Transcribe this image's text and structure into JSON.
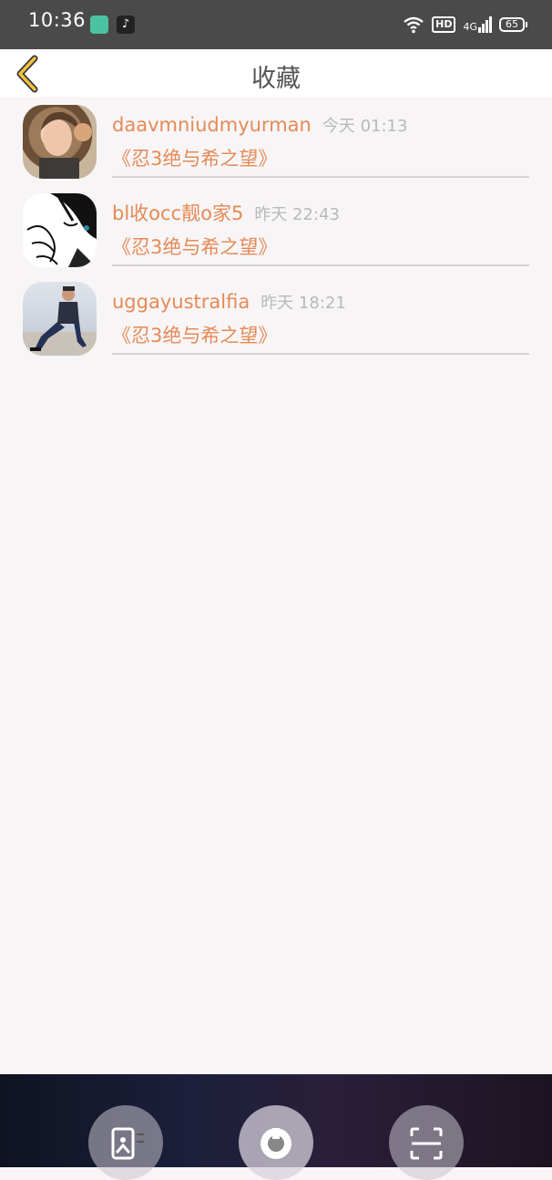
{
  "status_bar": {
    "time": "10:36",
    "hd": "HD",
    "network": "4G",
    "battery": "65"
  },
  "header": {
    "title": "收藏"
  },
  "favorites": [
    {
      "username": "daavmniudmyurman",
      "time": "今天 01:13",
      "content": "《忍3绝与希之望》"
    },
    {
      "username": "bl收occ靓o家5",
      "time": "昨天 22:43",
      "content": "《忍3绝与希之望》"
    },
    {
      "username": "uggayustralfia",
      "time": "昨天 18:21",
      "content": "《忍3绝与希之望》"
    }
  ],
  "colors": {
    "accent": "#e58a56",
    "back_arrow": "#f0c040",
    "time_text": "#b9b9b9"
  },
  "icons": {
    "back": "chevron-left-icon",
    "dock": [
      "image-icon",
      "circle-icon",
      "scan-icon"
    ]
  }
}
